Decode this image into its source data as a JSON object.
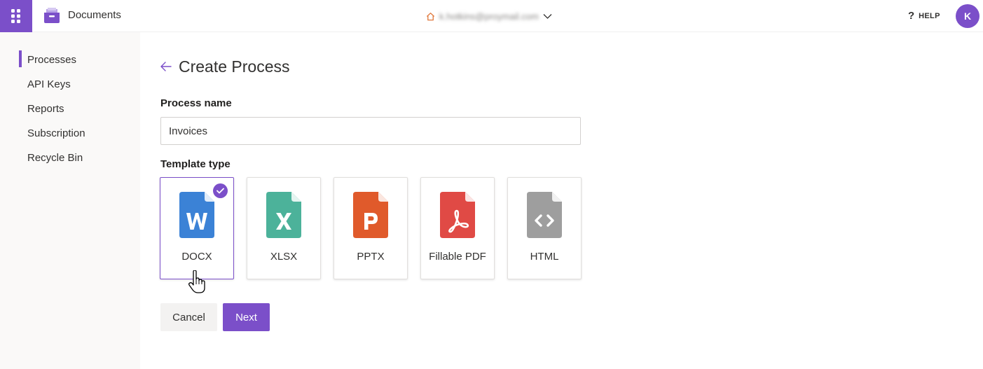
{
  "header": {
    "app_title": "Documents",
    "account_email": "k.hotkins@proymail.com",
    "help_label": "HELP",
    "avatar_initial": "K"
  },
  "sidebar": {
    "items": [
      {
        "label": "Processes",
        "active": true
      },
      {
        "label": "API Keys",
        "active": false
      },
      {
        "label": "Reports",
        "active": false
      },
      {
        "label": "Subscription",
        "active": false
      },
      {
        "label": "Recycle Bin",
        "active": false
      }
    ]
  },
  "main": {
    "title": "Create Process",
    "process_name_label": "Process name",
    "process_name_value": "Invoices",
    "template_type_label": "Template type",
    "templates": [
      {
        "label": "DOCX",
        "icon": "word-file-icon",
        "color": "#3b82d6",
        "selected": true
      },
      {
        "label": "XLSX",
        "icon": "excel-file-icon",
        "color": "#4cb29a",
        "selected": false
      },
      {
        "label": "PPTX",
        "icon": "powerpoint-file-icon",
        "color": "#e05a2b",
        "selected": false
      },
      {
        "label": "Fillable PDF",
        "icon": "pdf-file-icon",
        "color": "#e04a45",
        "selected": false
      },
      {
        "label": "HTML",
        "icon": "html-file-icon",
        "color": "#9e9e9e",
        "selected": false
      }
    ],
    "cancel_label": "Cancel",
    "next_label": "Next"
  },
  "colors": {
    "accent": "#7b4fc9",
    "sidebar_bg": "#faf9f8"
  }
}
